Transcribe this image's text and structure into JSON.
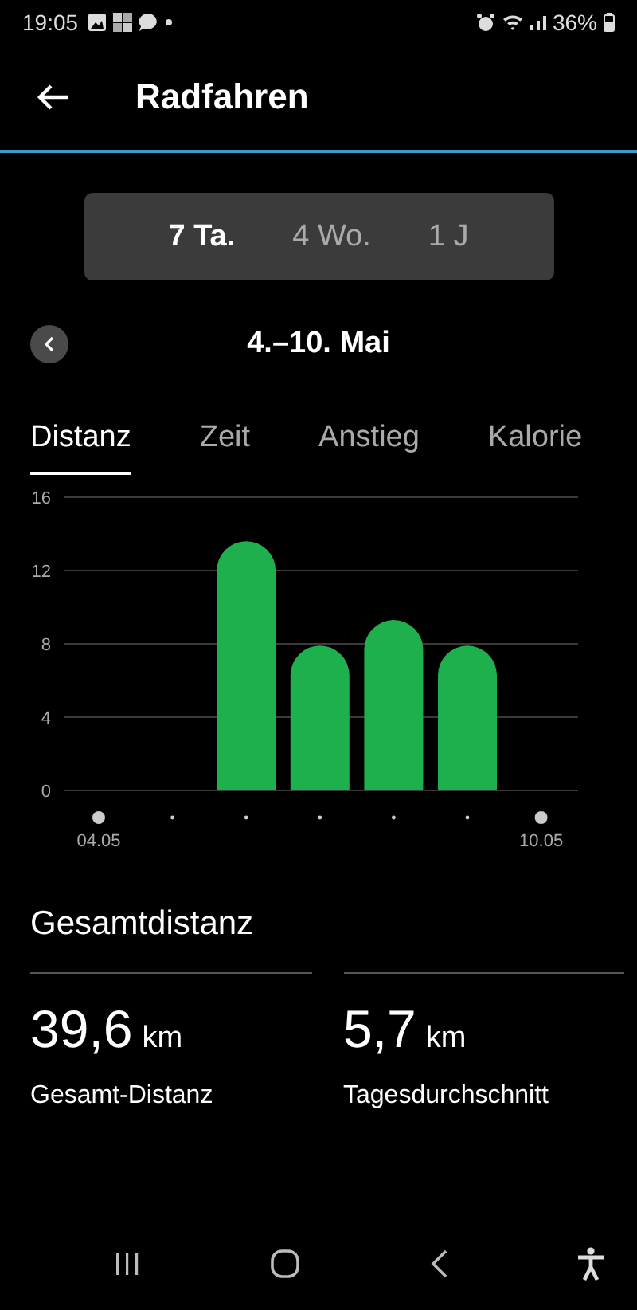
{
  "status_bar": {
    "time": "19:05",
    "battery": "36%"
  },
  "header": {
    "title": "Radfahren"
  },
  "periods": [
    {
      "label": "7 Ta.",
      "selected": true
    },
    {
      "label": "4 Wo.",
      "selected": false
    },
    {
      "label": "1 J",
      "selected": false
    }
  ],
  "date_range": "4.–10. Mai",
  "tabs": [
    {
      "label": "Distanz",
      "selected": true
    },
    {
      "label": "Zeit",
      "selected": false
    },
    {
      "label": "Anstieg",
      "selected": false
    },
    {
      "label": "Kalorie",
      "selected": false
    }
  ],
  "chart_data": {
    "type": "bar",
    "categories": [
      "04.05",
      null,
      null,
      null,
      null,
      null,
      "10.05"
    ],
    "series": [
      {
        "color": "#1db04c",
        "values": [
          null,
          null,
          13.6,
          7.9,
          9.3,
          7.9,
          null
        ]
      }
    ],
    "ylim": [
      0,
      16
    ],
    "yticks": [
      0,
      4,
      8,
      12,
      16
    ],
    "grid": true
  },
  "summary": {
    "title": "Gesamtdistanz",
    "stats": [
      {
        "value": "39,6",
        "unit": "km",
        "label": "Gesamt-Distanz"
      },
      {
        "value": "5,7",
        "unit": "km",
        "label": "Tagesdurchschnitt"
      }
    ]
  }
}
